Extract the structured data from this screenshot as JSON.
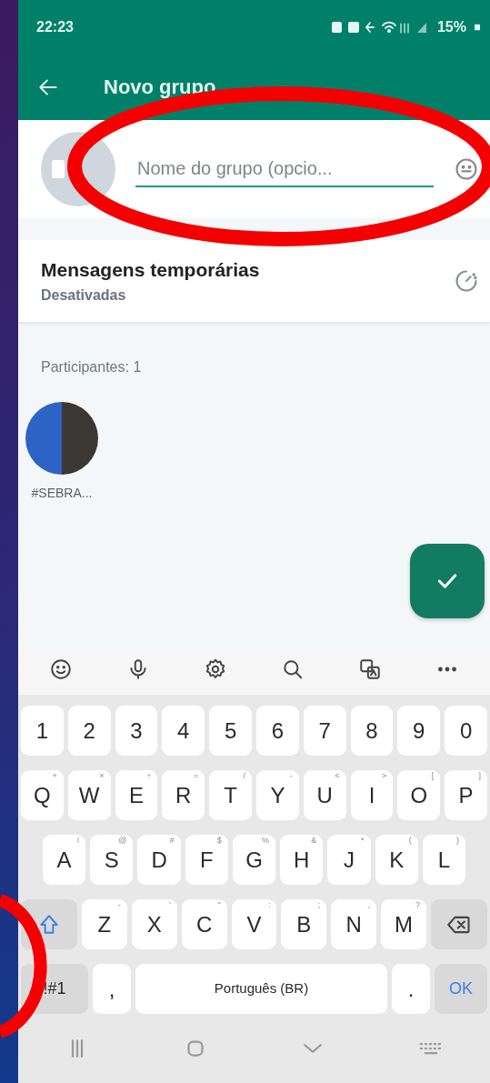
{
  "status_bar": {
    "time": "22:23",
    "battery": "15%"
  },
  "app_bar": {
    "title": "Novo grupo"
  },
  "group_name": {
    "placeholder": "Nome do grupo (opcio..."
  },
  "disappearing": {
    "title": "Mensagens temporárias",
    "value": "Desativadas"
  },
  "participants": {
    "label": "Participantes: 1",
    "members": [
      {
        "name": "#SEBRA..."
      }
    ]
  },
  "keyboard": {
    "shift_on": true,
    "rows": [
      {
        "keys": [
          {
            "label": "1"
          },
          {
            "label": "2"
          },
          {
            "label": "3"
          },
          {
            "label": "4"
          },
          {
            "label": "5"
          },
          {
            "label": "6"
          },
          {
            "label": "7"
          },
          {
            "label": "8"
          },
          {
            "label": "9"
          },
          {
            "label": "0"
          }
        ]
      },
      {
        "keys": [
          {
            "label": "Q",
            "hint": "+"
          },
          {
            "label": "W",
            "hint": "×"
          },
          {
            "label": "E",
            "hint": "÷"
          },
          {
            "label": "R",
            "hint": "="
          },
          {
            "label": "T",
            "hint": "/"
          },
          {
            "label": "Y",
            "hint": "-"
          },
          {
            "label": "U",
            "hint": "<"
          },
          {
            "label": "I",
            "hint": ">"
          },
          {
            "label": "O",
            "hint": "["
          },
          {
            "label": "P",
            "hint": "]"
          }
        ]
      },
      {
        "keys": [
          {
            "label": "A",
            "hint": "!"
          },
          {
            "label": "S",
            "hint": "@"
          },
          {
            "label": "D",
            "hint": "#"
          },
          {
            "label": "F",
            "hint": "$"
          },
          {
            "label": "G",
            "hint": "%"
          },
          {
            "label": "H",
            "hint": "&"
          },
          {
            "label": "J",
            "hint": "*"
          },
          {
            "label": "K",
            "hint": "("
          },
          {
            "label": "L",
            "hint": ")"
          }
        ]
      },
      {
        "keys": [
          {
            "kind": "shift"
          },
          {
            "label": "Z",
            "hint": "-"
          },
          {
            "label": "X",
            "hint": "'"
          },
          {
            "label": "C",
            "hint": "\""
          },
          {
            "label": "V",
            "hint": ":"
          },
          {
            "label": "B",
            "hint": ";"
          },
          {
            "label": "N",
            "hint": ","
          },
          {
            "label": "M",
            "hint": "?"
          },
          {
            "kind": "backspace"
          }
        ]
      },
      {
        "keys": [
          {
            "kind": "symbols",
            "label": "!#1"
          },
          {
            "kind": "small",
            "label": ","
          },
          {
            "kind": "space",
            "label": "Português (BR)"
          },
          {
            "kind": "small",
            "label": "."
          },
          {
            "kind": "ok",
            "label": "OK"
          }
        ]
      }
    ]
  }
}
